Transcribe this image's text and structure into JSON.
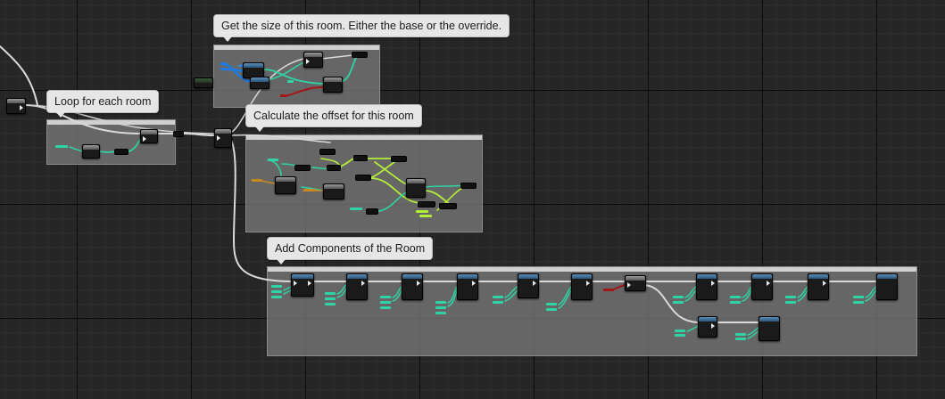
{
  "comments": {
    "get_size": "Get the size of this room. Either the base or the override.",
    "loop_rooms": "Loop for each room",
    "calc_offset": "Calculate the offset for this room",
    "add_components": "Add Components of the Room"
  },
  "colors": {
    "exec_wire": "#d9d9d9",
    "data_teal": "#2fd3a5",
    "data_lime": "#b3ec3a",
    "data_blue": "#1c7ce6",
    "data_red": "#a31616",
    "data_orange": "#c88a1e",
    "comment_fill": "#808080"
  }
}
